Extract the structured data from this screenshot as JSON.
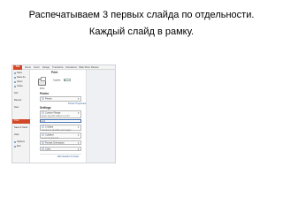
{
  "title": {
    "line1": "Распечатываем 3  первых слайда по отдельности.",
    "line2": "Каждый слайд в рамку."
  },
  "ribbon": {
    "file_tab": "File",
    "tabs": [
      "Home",
      "Insert",
      "Design",
      "Transitions",
      "Animations",
      "Slide Show",
      "Review"
    ]
  },
  "backstage_nav": {
    "items": [
      "Save",
      "Save As",
      "Open",
      "Close",
      "Info",
      "Recent",
      "New",
      "Print",
      "Save & Send",
      "Help",
      "Options",
      "Exit"
    ],
    "active_index": 7
  },
  "print_panel": {
    "heading": "Print",
    "print_button": "Print",
    "copies_label": "Copies:",
    "copies_value": "1",
    "printer_heading": "Printer",
    "printer_name": "Printer",
    "printer_properties": "Printer Properties",
    "settings_heading": "Settings",
    "slides_range": "Custom Range",
    "slides_range_sub": "Enter specific slides to print",
    "slides_label": "Slides:",
    "slides_value": "1-3",
    "layout": "3 Slides",
    "layout_sub": "Handouts (3 slides per page)",
    "collation": "Collated",
    "collation_sub": "1,2,3  1,2,3  1,2,3",
    "orientation": "Portrait Orientation",
    "color": "Color",
    "edit_header_footer": "Edit Header & Footer"
  },
  "colors": {
    "accent": "#d24726",
    "input_border": "#3b6fb6"
  }
}
